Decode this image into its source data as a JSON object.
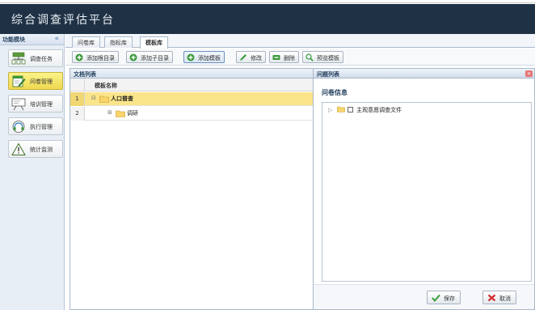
{
  "app": {
    "title": "综合调查评估平台"
  },
  "sidebar": {
    "title": "功能模块",
    "collapse_glyph": "«",
    "items": [
      {
        "label": "调查任务",
        "icon": "org-chart-icon",
        "active": false
      },
      {
        "label": "问卷管理",
        "icon": "edit-document-icon",
        "active": true
      },
      {
        "label": "培训管理",
        "icon": "presentation-board-icon",
        "active": false
      },
      {
        "label": "执行管理",
        "icon": "headset-icon",
        "active": false
      },
      {
        "label": "统计监测",
        "icon": "warning-triangle-icon",
        "active": false
      }
    ]
  },
  "tabs": [
    {
      "label": "问卷库",
      "active": false
    },
    {
      "label": "指标库",
      "active": false
    },
    {
      "label": "模板库",
      "active": true
    }
  ],
  "toolbar": {
    "buttons": [
      {
        "label": "添加根目录",
        "icon": "plus-circle-icon"
      },
      {
        "label": "添加子目录",
        "icon": "plus-circle-icon"
      },
      {
        "label": "添加模板",
        "icon": "plus-circle-icon"
      },
      {
        "label": "修改",
        "icon": "pencil-icon"
      },
      {
        "label": "删除",
        "icon": "minus-icon"
      },
      {
        "label": "预览模板",
        "icon": "magnifier-icon"
      }
    ]
  },
  "doc_panel": {
    "title": "文档列表",
    "column_header": "模板名称",
    "rows": [
      {
        "num": "1",
        "label": "人口普查",
        "expander": "⊟",
        "selected": true
      },
      {
        "num": "2",
        "label": "调研",
        "expander": "⊞",
        "selected": false
      }
    ]
  },
  "dialog": {
    "title": "问题列表",
    "close_glyph": "×",
    "subtitle": "问卷信息",
    "tree_item": {
      "expander": "▷",
      "label": "主观意愿调查文件"
    },
    "save_label": "保存",
    "cancel_label": "取消"
  },
  "colors": {
    "header_bg": "#1f3245",
    "active_nav": "#eed84e",
    "selected_row": "#fbe58a",
    "accent_green": "#3a9a3a"
  }
}
